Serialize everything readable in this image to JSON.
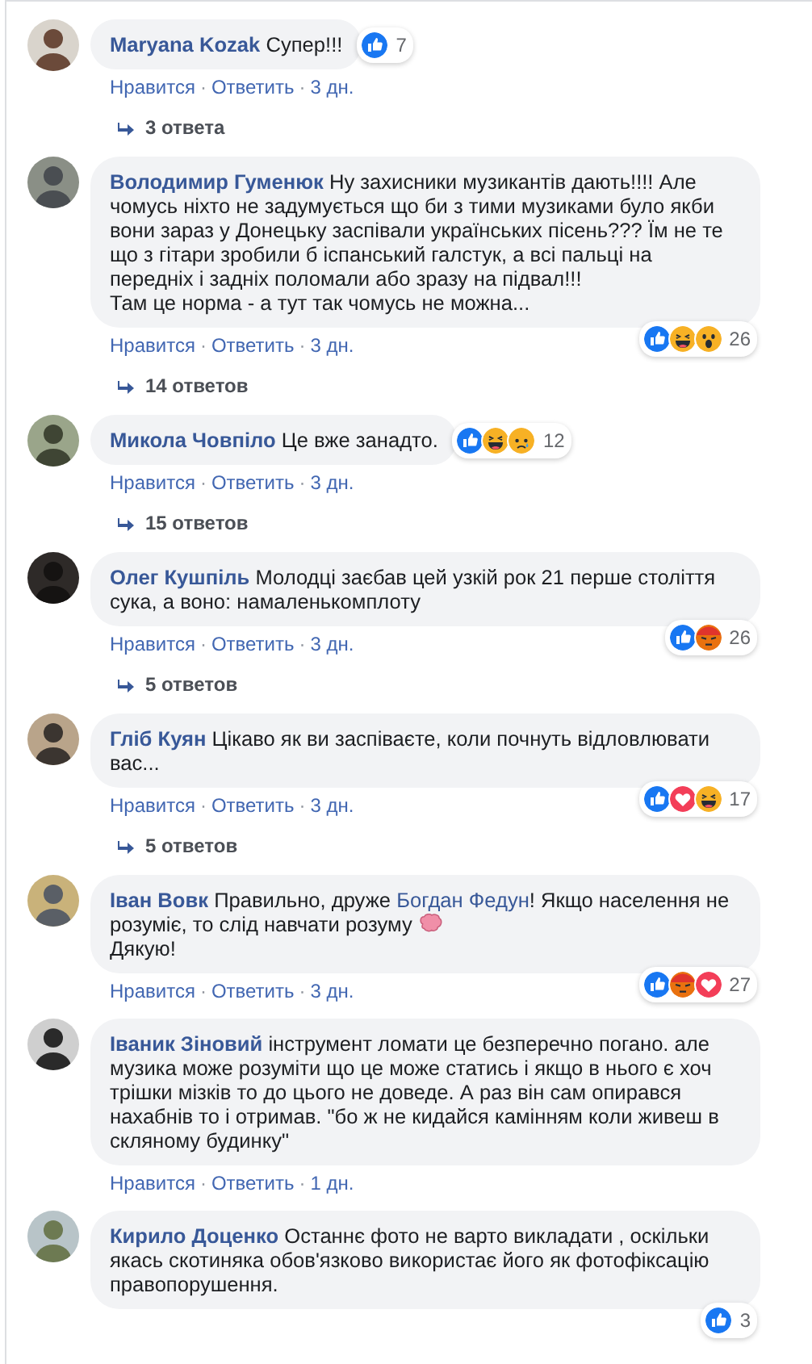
{
  "comments": [
    {
      "author": "Maryana Kozak",
      "segments": [
        {
          "kind": "text",
          "text": "Супер!!!"
        }
      ],
      "reactions": {
        "icons": [
          {
            "kind": "like"
          }
        ],
        "count": "7"
      },
      "actions": {
        "like": "Нравится",
        "separator_1": "·",
        "reply": "Ответить",
        "separator_2": "·",
        "time": "3 дн."
      },
      "replies": "3 ответа"
    },
    {
      "author": "Володимир Гуменюк",
      "segments": [
        {
          "kind": "text",
          "text": "Ну захисники музикантів дають!!!! Але чомусь ніхто не задумується що би з тими музиками було якби вони зараз у Донецьку заспівали українських пісень??? Їм не те що з гітари зробили б іспанський галстук, а всі пальці на передніх і задніх поломали або зразу на підвал!!!\nТам це норма - а тут так чомусь не можна..."
        }
      ],
      "reactions": {
        "icons": [
          {
            "kind": "like"
          },
          {
            "kind": "haha"
          },
          {
            "kind": "wow"
          }
        ],
        "count": "26"
      },
      "actions": {
        "like": "Нравится",
        "separator_1": "·",
        "reply": "Ответить",
        "separator_2": "·",
        "time": "3 дн."
      },
      "replies": "14 ответов"
    },
    {
      "author": "Микола Човпіло",
      "segments": [
        {
          "kind": "text",
          "text": "Це вже занадто."
        }
      ],
      "reactions": {
        "icons": [
          {
            "kind": "like"
          },
          {
            "kind": "haha"
          },
          {
            "kind": "sad"
          }
        ],
        "count": "12"
      },
      "actions": {
        "like": "Нравится",
        "separator_1": "·",
        "reply": "Ответить",
        "separator_2": "·",
        "time": "3 дн."
      },
      "replies": "15 ответов"
    },
    {
      "author": "Олег Кушпіль",
      "segments": [
        {
          "kind": "text",
          "text": "Молодці заєбав цей узкій рок 21 перше століття сука, а воно: намаленькомплоту"
        }
      ],
      "reactions": {
        "icons": [
          {
            "kind": "like"
          },
          {
            "kind": "angry"
          }
        ],
        "count": "26"
      },
      "actions": {
        "like": "Нравится",
        "separator_1": "·",
        "reply": "Ответить",
        "separator_2": "·",
        "time": "3 дн."
      },
      "replies": "5 ответов"
    },
    {
      "author": "Гліб Куян",
      "segments": [
        {
          "kind": "text",
          "text": "Цікаво як ви заспіваєте, коли почнуть відловлювати вас..."
        }
      ],
      "reactions": {
        "icons": [
          {
            "kind": "like"
          },
          {
            "kind": "love"
          },
          {
            "kind": "haha"
          }
        ],
        "count": "17"
      },
      "actions": {
        "like": "Нравится",
        "separator_1": "·",
        "reply": "Ответить",
        "separator_2": "·",
        "time": "3 дн."
      },
      "replies": "5 ответов"
    },
    {
      "author": "Іван Вовк",
      "segments": [
        {
          "kind": "text",
          "text": "Правильно, друже "
        },
        {
          "kind": "link",
          "text": "Богдан Федун"
        },
        {
          "kind": "text",
          "text": "! Якщо населення не розуміє, то слід навчати розуму "
        },
        {
          "kind": "emoji"
        },
        {
          "kind": "text",
          "text": "\nДякую!"
        }
      ],
      "reactions": {
        "icons": [
          {
            "kind": "like"
          },
          {
            "kind": "angry"
          },
          {
            "kind": "love"
          }
        ],
        "count": "27"
      },
      "actions": {
        "like": "Нравится",
        "separator_1": "·",
        "reply": "Ответить",
        "separator_2": "·",
        "time": "3 дн."
      }
    },
    {
      "author": "Іваник Зіновий",
      "segments": [
        {
          "kind": "text",
          "text": "інструмент ломати це безперечно погано. але музика може розуміти що це може статись і якщо в нього є хоч трішки мізків то до цього не доведе. А раз він сам опирався нахабнів то і отримав. \"бо ж не кидайся камінням коли живеш в скляному будинку\""
        }
      ],
      "actions": {
        "like": "Нравится",
        "separator_1": "·",
        "reply": "Ответить",
        "separator_2": "·",
        "time": "1 дн."
      }
    },
    {
      "author": "Кирило Доценко",
      "segments": [
        {
          "kind": "text",
          "text": "Останнє фото не варто викладати , оскільки якась скотиняка обов'язково використає його як фотофіксацію правопорушення."
        }
      ],
      "reactions": {
        "icons": [
          {
            "kind": "like"
          }
        ],
        "count": "3"
      }
    }
  ]
}
